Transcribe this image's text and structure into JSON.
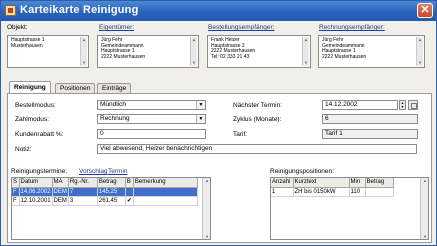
{
  "window": {
    "title": "Karteikarte Reinigung",
    "close_glyph": "✕"
  },
  "header": {
    "objekt_label": "Objekt:",
    "eigentuemer_label": "Eigentümer:",
    "bestellung_label": "Bestellungsempfänger:",
    "rechnung_label": "Rechnungsempfänger:",
    "objekt_lines": [
      "Hauptstrasse 1",
      "Musterhausen"
    ],
    "eigentuemer_lines": [
      "Jürg Fehr",
      "Gemeindeammann",
      "Hauptstrasse 1",
      "2222 Musterhausen"
    ],
    "bestellung_lines": [
      "Frank Heizer",
      "Hauptstrasse 2",
      "2222 Musterhausen",
      "Tel: 02 333 21 43"
    ],
    "rechnung_lines": [
      "Jürg Fehr",
      "Gemeindeammann",
      "Hauptstrasse 1",
      "2222 Musterhausen"
    ]
  },
  "tabs": [
    "Reinigung",
    "Positionen",
    "Einträge"
  ],
  "form": {
    "bestellmodus_label": "Bestellmodus:",
    "bestellmodus_value": "Mündlich",
    "zahlmodus_label": "Zahlmodus:",
    "zahlmodus_value": "Rechnung",
    "rabatt_label": "Kundenrabatt %:",
    "rabatt_value": "0",
    "notiz_label": "Notiz:",
    "notiz_value": "Viel abwesend, Heizer benachrichtigen",
    "termin_label": "Nächster Termin:",
    "termin_value": "14.12.2002",
    "zyklus_label": "Zyklus (Monate):",
    "zyklus_value": "6",
    "tarif_label": "Tarif:",
    "tarif_value": "Tarif 1"
  },
  "termine": {
    "label": "Reinigungstermine:",
    "link_vorschlag": "Vorschlag",
    "link_termin": "Termin",
    "columns": [
      "S",
      "Datum",
      "MA",
      "Rg.-Nr.",
      "Betrag",
      "B",
      "Bemerkung"
    ],
    "rows": [
      {
        "s": "F",
        "datum": "14.06.2002",
        "ma": "DEM",
        "rg": "7",
        "betrag": "145.25",
        "b": "",
        "bem": "",
        "selected": true
      },
      {
        "s": "F",
        "datum": "12.10.2001",
        "ma": "DEM",
        "rg": "3",
        "betrag": "261.45",
        "b": "✔",
        "bem": "",
        "selected": false
      }
    ]
  },
  "positionen": {
    "label": "Reinigungspositionen:",
    "columns": [
      "Anzahl",
      "Kurztext",
      "Min",
      "Betrag"
    ],
    "rows": [
      {
        "anzahl": "1",
        "kurztext": "ZH bis 0150kW",
        "min": "110",
        "betrag": ""
      }
    ]
  }
}
